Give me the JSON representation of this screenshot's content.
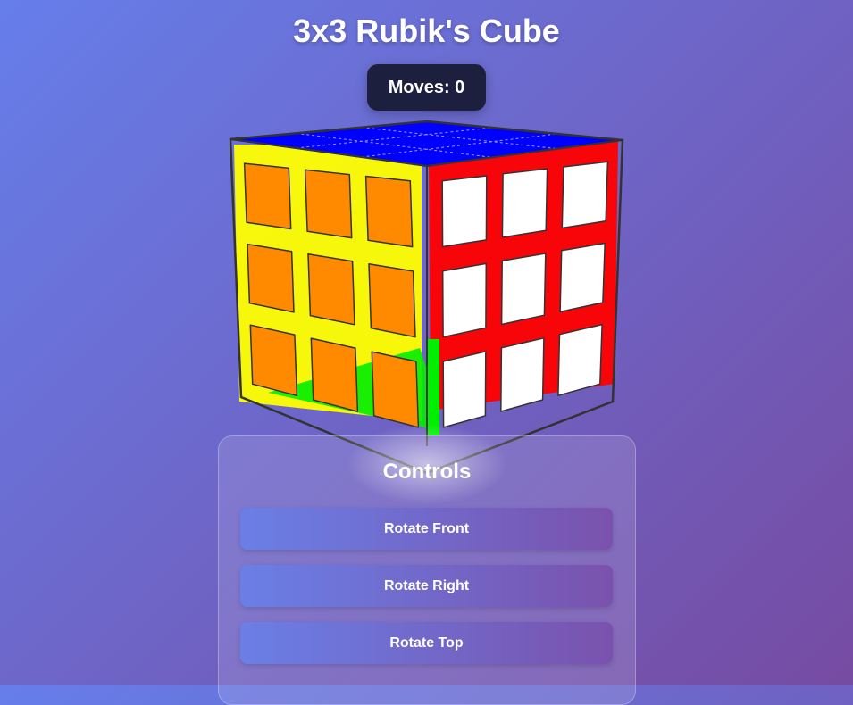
{
  "app": {
    "title": "3x3 Rubik's Cube"
  },
  "status": {
    "moves_label": "Moves: 0"
  },
  "controls": {
    "title": "Controls",
    "buttons": [
      {
        "label": "Rotate Front"
      },
      {
        "label": "Rotate Right"
      },
      {
        "label": "Rotate Top"
      }
    ]
  },
  "colors": {
    "orange": "#ff8a00",
    "white": "#ffffff",
    "blue": "#0000ff",
    "yellow": "#ffff00",
    "red": "#ff0000",
    "green": "#00ee00",
    "accent_dark": "#1c1f3d"
  },
  "cube": {
    "visible_faces": {
      "front": "orange",
      "right": "white",
      "top": "blue"
    },
    "inner_faces": [
      "yellow",
      "red",
      "green"
    ]
  }
}
